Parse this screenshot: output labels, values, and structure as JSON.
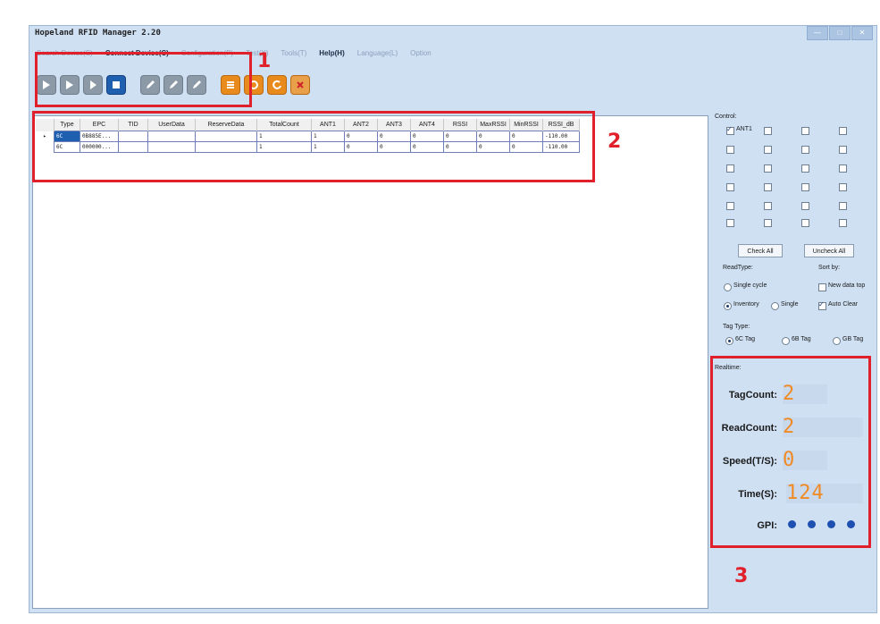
{
  "window": {
    "title": "Hopeland RFID Manager 2.20"
  },
  "menu": [
    "Search Device(S)",
    "Connect Device(C)",
    "Configuration(P)",
    "Test(X)",
    "Tools(T)",
    "Help(H)",
    "Language(L)",
    "Option"
  ],
  "table": {
    "headers": [
      "Type",
      "EPC",
      "TID",
      "UserData",
      "ReserveData",
      "TotalCount",
      "ANT1",
      "ANT2",
      "ANT3",
      "ANT4",
      "RSSI",
      "MaxRSSI",
      "MinRSSI",
      "RSSI_dB"
    ],
    "rows": [
      [
        "6C",
        "0B885E...",
        "",
        "",
        "",
        "1",
        "1",
        "0",
        "0",
        "0",
        "0",
        "0",
        "0",
        "-110.00"
      ],
      [
        "6C",
        "000000...",
        "",
        "",
        "",
        "1",
        "1",
        "0",
        "0",
        "0",
        "0",
        "0",
        "0",
        "-110.00"
      ]
    ]
  },
  "control": {
    "label": "Control:",
    "ant1_label": "ANT1",
    "check_all": "Check All",
    "uncheck_all": "Uncheck All",
    "read_type_label": "ReadType:",
    "sort_by_label": "Sort by:",
    "single_cycle": "Single cycle",
    "new_data_top": "New data top",
    "inventory": "Inventory",
    "single": "Single",
    "auto_clear": "Auto Clear",
    "tag_type_label": "Tag Type:",
    "tag_types": [
      "6C Tag",
      "6B Tag",
      "GB Tag"
    ]
  },
  "realtime": {
    "label": "Realtime:",
    "tag_count_label": "TagCount:",
    "tag_count": "2",
    "read_count_label": "ReadCount:",
    "read_count": "2",
    "speed_label": "Speed(T/S):",
    "speed": "0",
    "time_label": "Time(S):",
    "time": "124",
    "gpi_label": "GPI:"
  },
  "annotations": [
    "1",
    "2",
    "3"
  ],
  "colors": {
    "highlight": "#e0202a",
    "digit": "#f08a24",
    "gpi": "#1d50b0",
    "window": "#cfe0f3"
  }
}
